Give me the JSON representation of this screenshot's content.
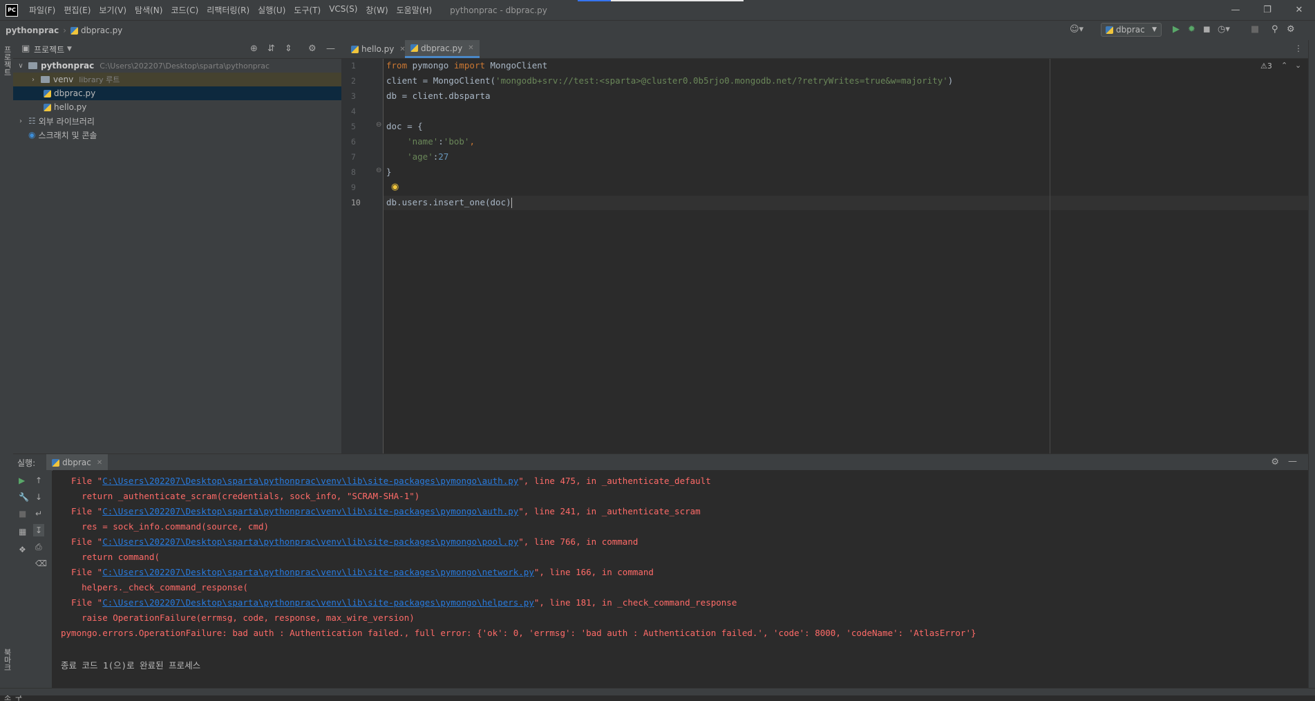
{
  "menu": {
    "items": [
      "파일(F)",
      "편집(E)",
      "보기(V)",
      "탐색(N)",
      "코드(C)",
      "리팩터링(R)",
      "실행(U)",
      "도구(T)",
      "VCS(S)",
      "창(W)",
      "도움말(H)"
    ],
    "window_title": "pythonprac - dbprac.py"
  },
  "nav": {
    "project": "pythonprac",
    "file": "dbprac.py",
    "run_config": "dbprac"
  },
  "left_stripe": {
    "project_tab": "프로젝트",
    "bookmarks_tab": "북마크",
    "structure_tab": "구조"
  },
  "project_panel": {
    "title": "프로젝트",
    "root": {
      "name": "pythonprac",
      "path": "C:\\Users\\202207\\Desktop\\sparta\\pythonprac"
    },
    "venv": {
      "name": "venv",
      "hint": "library 루트"
    },
    "files": [
      "dbprac.py",
      "hello.py"
    ],
    "external_libs": "외부 라이브러리",
    "scratches": "스크래치 및 콘솔"
  },
  "editor": {
    "tabs": [
      "hello.py",
      "dbprac.py"
    ],
    "warnings": "3",
    "line_numbers": [
      "1",
      "2",
      "3",
      "4",
      "5",
      "6",
      "7",
      "8",
      "9",
      "10"
    ],
    "code": {
      "l1_kw1": "from",
      "l1_mod": " pymongo ",
      "l1_kw2": "import",
      "l1_rest": " MongoClient",
      "l2_pre": "client = MongoClient(",
      "l2_str": "'mongodb+srv://test:<sparta>@cluster0.0b5rjo0.mongodb.net/?retryWrites=true&w=majority'",
      "l2_post": ")",
      "l3": "db = client.dbsparta",
      "l5": "doc = {",
      "l6_key": "'name'",
      "l6_colon": ":",
      "l6_val": "'bob'",
      "l6_comma": ",",
      "l7_key": "'age'",
      "l7_colon": ":",
      "l7_val": "27",
      "l8": "}",
      "l10": "db.users.insert_one(doc)"
    }
  },
  "run_panel": {
    "label": "실행:",
    "tab": "dbprac",
    "lines": [
      {
        "type": "file",
        "pre": "  File \"",
        "link": "C:\\Users\\202207\\Desktop\\sparta\\pythonprac\\venv\\lib\\site-packages\\pymongo\\auth.py",
        "post": "\", line 475, in _authenticate_default"
      },
      {
        "type": "code",
        "text": "    return _authenticate_scram(credentials, sock_info, \"SCRAM-SHA-1\")"
      },
      {
        "type": "file",
        "pre": "  File \"",
        "link": "C:\\Users\\202207\\Desktop\\sparta\\pythonprac\\venv\\lib\\site-packages\\pymongo\\auth.py",
        "post": "\", line 241, in _authenticate_scram"
      },
      {
        "type": "code",
        "text": "    res = sock_info.command(source, cmd)"
      },
      {
        "type": "file",
        "pre": "  File \"",
        "link": "C:\\Users\\202207\\Desktop\\sparta\\pythonprac\\venv\\lib\\site-packages\\pymongo\\pool.py",
        "post": "\", line 766, in command"
      },
      {
        "type": "code",
        "text": "    return command("
      },
      {
        "type": "file",
        "pre": "  File \"",
        "link": "C:\\Users\\202207\\Desktop\\sparta\\pythonprac\\venv\\lib\\site-packages\\pymongo\\network.py",
        "post": "\", line 166, in command"
      },
      {
        "type": "code",
        "text": "    helpers._check_command_response("
      },
      {
        "type": "file",
        "pre": "  File \"",
        "link": "C:\\Users\\202207\\Desktop\\sparta\\pythonprac\\venv\\lib\\site-packages\\pymongo\\helpers.py",
        "post": "\", line 181, in _check_command_response"
      },
      {
        "type": "code",
        "text": "    raise OperationFailure(errmsg, code, response, max_wire_version)"
      },
      {
        "type": "code",
        "text": "pymongo.errors.OperationFailure: bad auth : Authentication failed., full error: {'ok': 0, 'errmsg': 'bad auth : Authentication failed.', 'code': 8000, 'codeName': 'AtlasError'}"
      },
      {
        "type": "blank",
        "text": ""
      },
      {
        "type": "normal",
        "text": "종료 코드 1(으)로 완료된 프로세스"
      }
    ]
  }
}
